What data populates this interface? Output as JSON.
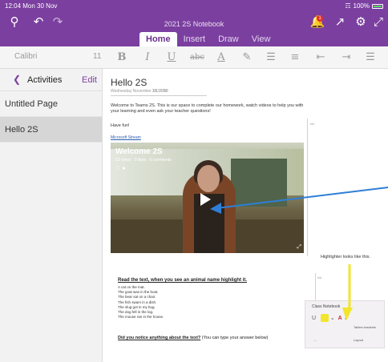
{
  "status_bar": {
    "time": "12:04",
    "date": "Mon 30 Nov",
    "battery": "100%"
  },
  "header": {
    "notebook_title": "2021 2S Notebook",
    "notification_count": "1",
    "tabs": [
      {
        "label": "Home",
        "active": true
      },
      {
        "label": "Insert",
        "active": false
      },
      {
        "label": "Draw",
        "active": false
      },
      {
        "label": "View",
        "active": false
      }
    ]
  },
  "toolbar": {
    "font_name": "Calibri",
    "font_size": "11",
    "bold": "B",
    "italic": "I",
    "underline": "U",
    "strikethrough": "abc",
    "font_color": "A"
  },
  "nav": {
    "section_name": "Activities",
    "edit_label": "Edit",
    "pages": [
      {
        "label": "Untitled Page",
        "selected": false
      },
      {
        "label": "Hello 2S",
        "selected": true
      }
    ]
  },
  "page": {
    "title": "Hello 2S",
    "date": "Wednesday November 18, 2020",
    "time": "3:10 PM",
    "intro": "Welcome to Teams 2S. This is our space to complete our homework, watch videos to help you with your learning and even ask your teacher questions!",
    "greeting": "Have fun!",
    "link": "Microsoft Stream",
    "side_tag_1": "Ink",
    "side_tag_2": "Ink",
    "side_tag_3": "Ink",
    "video": {
      "title": "Welcome 2S",
      "meta": "12 views · 0 likes · 0 comments"
    },
    "highlight_note": "Highlighter looks like this.",
    "read_instruction": "Read the text, when you see an animal name highlight it.",
    "sentences": [
      "A cat on the mat.",
      "The goat was in the boat.",
      "The bear sat on a chair.",
      "The fish swam in a dish.",
      "The slug got in my bug.",
      "The dog fell in the log.",
      "The mouse ran in the house."
    ],
    "notice_bold": "Did you notice anything about the text?",
    "notice_rest": " (You can type your answer below)",
    "mini_toolbar": {
      "heading": "Class Notebook",
      "row1": "Tables brackets",
      "row2": "Layout",
      "dots": "..."
    }
  },
  "colors": {
    "brand_purple": "#7b3fa0",
    "arrow_blue": "#2e7fd6",
    "highlighter_yellow": "#f2e52c"
  }
}
